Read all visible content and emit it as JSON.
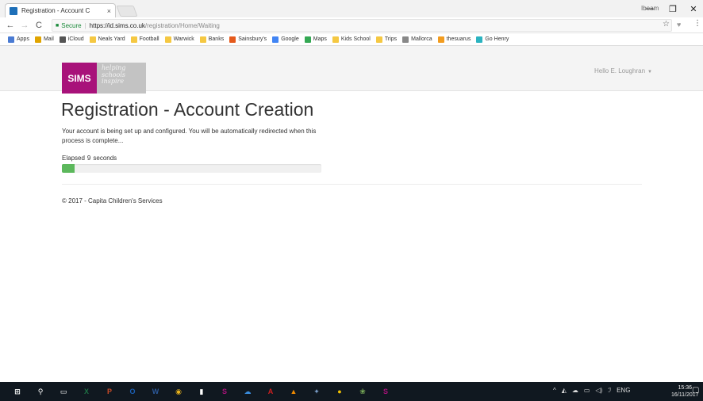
{
  "browser": {
    "tab_title": "Registration - Account C",
    "tab_close": "×",
    "window_user": "Ibeam",
    "window_controls": {
      "minimize": "—",
      "maximize": "❐",
      "close": "✕"
    },
    "nav": {
      "back": "←",
      "forward": "→",
      "reload": "C"
    },
    "secure_label": "Secure",
    "url_host": "https://id.sims.co.uk",
    "url_path": "/registration/Home/Waiting",
    "star": "☆",
    "extension": "♥",
    "menu": "⋮",
    "bookmarks": [
      {
        "label": "Apps",
        "icon": "apps-icon",
        "color": "#4a7bd3"
      },
      {
        "label": "Mail",
        "icon": "mail-icon",
        "color": "#e0a400"
      },
      {
        "label": "iCloud",
        "icon": "apple-icon",
        "color": "#555555"
      },
      {
        "label": "Neals Yard",
        "icon": "folder-icon",
        "color": "#f5c842"
      },
      {
        "label": "Football",
        "icon": "folder-icon",
        "color": "#f5c842"
      },
      {
        "label": "Warwick",
        "icon": "folder-icon",
        "color": "#f5c842"
      },
      {
        "label": "Banks",
        "icon": "folder-icon",
        "color": "#f5c842"
      },
      {
        "label": "Sainsbury's",
        "icon": "sainsburys-icon",
        "color": "#e55a1c"
      },
      {
        "label": "Google",
        "icon": "google-icon",
        "color": "#4285f4"
      },
      {
        "label": "Maps",
        "icon": "maps-icon",
        "color": "#34a853"
      },
      {
        "label": "Kids School",
        "icon": "folder-icon",
        "color": "#f5c842"
      },
      {
        "label": "Trips",
        "icon": "folder-icon",
        "color": "#f5c842"
      },
      {
        "label": "Mallorca",
        "icon": "page-icon",
        "color": "#888888"
      },
      {
        "label": "thesuarus",
        "icon": "thesaurus-icon",
        "color": "#f29c1f"
      },
      {
        "label": "Go Henry",
        "icon": "gohenry-icon",
        "color": "#2bb3c0"
      }
    ]
  },
  "site": {
    "logo_text": "SIMS",
    "logo_tagline": [
      "helping",
      "schools",
      "inspire"
    ],
    "user_greeting": "Hello E. Loughran",
    "user_caret": "▼",
    "colors": {
      "brand": "#a8127a",
      "progress": "#5cb85c"
    }
  },
  "main": {
    "title": "Registration - Account Creation",
    "message": "Your account is being set up and configured. You will be automatically redirected when this process is complete...",
    "elapsed_prefix": "Elapsed",
    "elapsed_value": "9",
    "elapsed_unit": "seconds",
    "progress_fraction": 0.05
  },
  "footer": {
    "text": "© 2017 - Capita Children's Services"
  },
  "taskbar": {
    "items": [
      {
        "name": "windows-start-icon",
        "glyph": "⊞"
      },
      {
        "name": "search-icon",
        "glyph": "⚲"
      },
      {
        "name": "task-view-icon",
        "glyph": "▭"
      },
      {
        "name": "excel-icon",
        "glyph": "X"
      },
      {
        "name": "powerpoint-icon",
        "glyph": "P"
      },
      {
        "name": "outlook-icon",
        "glyph": "O"
      },
      {
        "name": "word-icon",
        "glyph": "W"
      },
      {
        "name": "chrome-icon",
        "glyph": "◉"
      },
      {
        "name": "file-icon",
        "glyph": "▮"
      },
      {
        "name": "sims-app-icon",
        "glyph": "S"
      },
      {
        "name": "onedrive-icon",
        "glyph": "☁"
      },
      {
        "name": "acrobat-icon",
        "glyph": "A"
      },
      {
        "name": "vlc-icon",
        "glyph": "▲"
      },
      {
        "name": "app-icon",
        "glyph": "✦"
      },
      {
        "name": "app-icon-2",
        "glyph": "●"
      },
      {
        "name": "app-icon-3",
        "glyph": "❀"
      },
      {
        "name": "sims-app-icon-2",
        "glyph": "S"
      }
    ],
    "tray_language": "ENG",
    "time": "15:36",
    "date": "16/11/2017"
  }
}
